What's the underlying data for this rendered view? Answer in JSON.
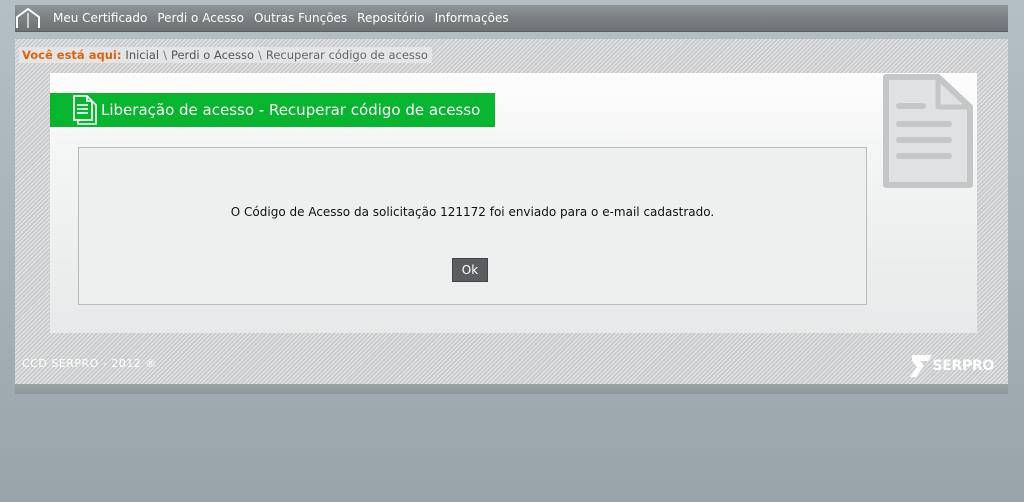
{
  "nav": {
    "home_icon": "home-icon",
    "items": [
      "Meu Certificado",
      "Perdi o Acesso",
      "Outras Funções",
      "Repositório",
      "Informações"
    ]
  },
  "breadcrumb": {
    "label": "Você está aqui:",
    "items": [
      "Inicial",
      "Perdi o Acesso",
      "Recuperar código de acesso"
    ]
  },
  "panel": {
    "title": "Liberação de acesso - Recuperar código de acesso",
    "title_icon": "document-icon",
    "message": "O Código de Acesso da solicitação 121172 foi enviado para o e-mail cadastrado.",
    "ok_label": "Ok"
  },
  "footer": {
    "copyright": "CCD SERPRO - 2012 ®",
    "logo_text": "SERPRO"
  },
  "colors": {
    "accent_green": "#08b52f",
    "breadcrumb_label": "#e0630c",
    "nav_bg": "#7a7f82"
  }
}
